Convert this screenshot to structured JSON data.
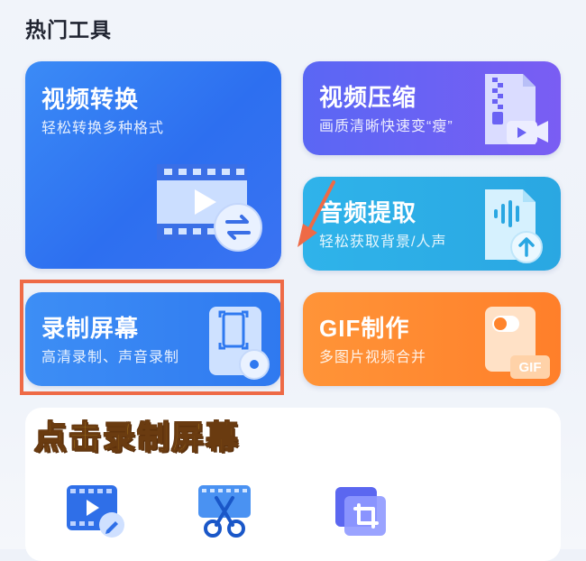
{
  "section": {
    "title": "热门工具"
  },
  "cards": [
    {
      "key": "video_convert",
      "title": "视频转换",
      "subtitle": "轻松转换多种格式",
      "icon": "video-convert-icon",
      "color": "#2d6ff0"
    },
    {
      "key": "video_compress",
      "title": "视频压缩",
      "subtitle": "画质清晰快速变“瘦”",
      "icon": "zip-video-icon",
      "color": "#6a62f4"
    },
    {
      "key": "audio_extract",
      "title": "音频提取",
      "subtitle": "轻松获取背景/人声",
      "icon": "audio-file-icon",
      "color": "#2aa7e2"
    },
    {
      "key": "screen_record",
      "title": "录制屏幕",
      "subtitle": "高清录制、声音录制",
      "icon": "screen-record-icon",
      "color": "#2f79f0"
    },
    {
      "key": "gif_make",
      "title": "GIF制作",
      "subtitle": "多图片视频合并",
      "icon": "gif-file-icon",
      "badge": "GIF",
      "color": "#ff842c"
    }
  ],
  "annotation": {
    "callout": "点击录制屏幕",
    "highlight_color": "#ee6a46",
    "arrow_color": "#ee6a46"
  },
  "bottom_tools": [
    {
      "icon": "video-edit-icon"
    },
    {
      "icon": "video-cut-icon"
    },
    {
      "icon": "crop-icon"
    }
  ]
}
